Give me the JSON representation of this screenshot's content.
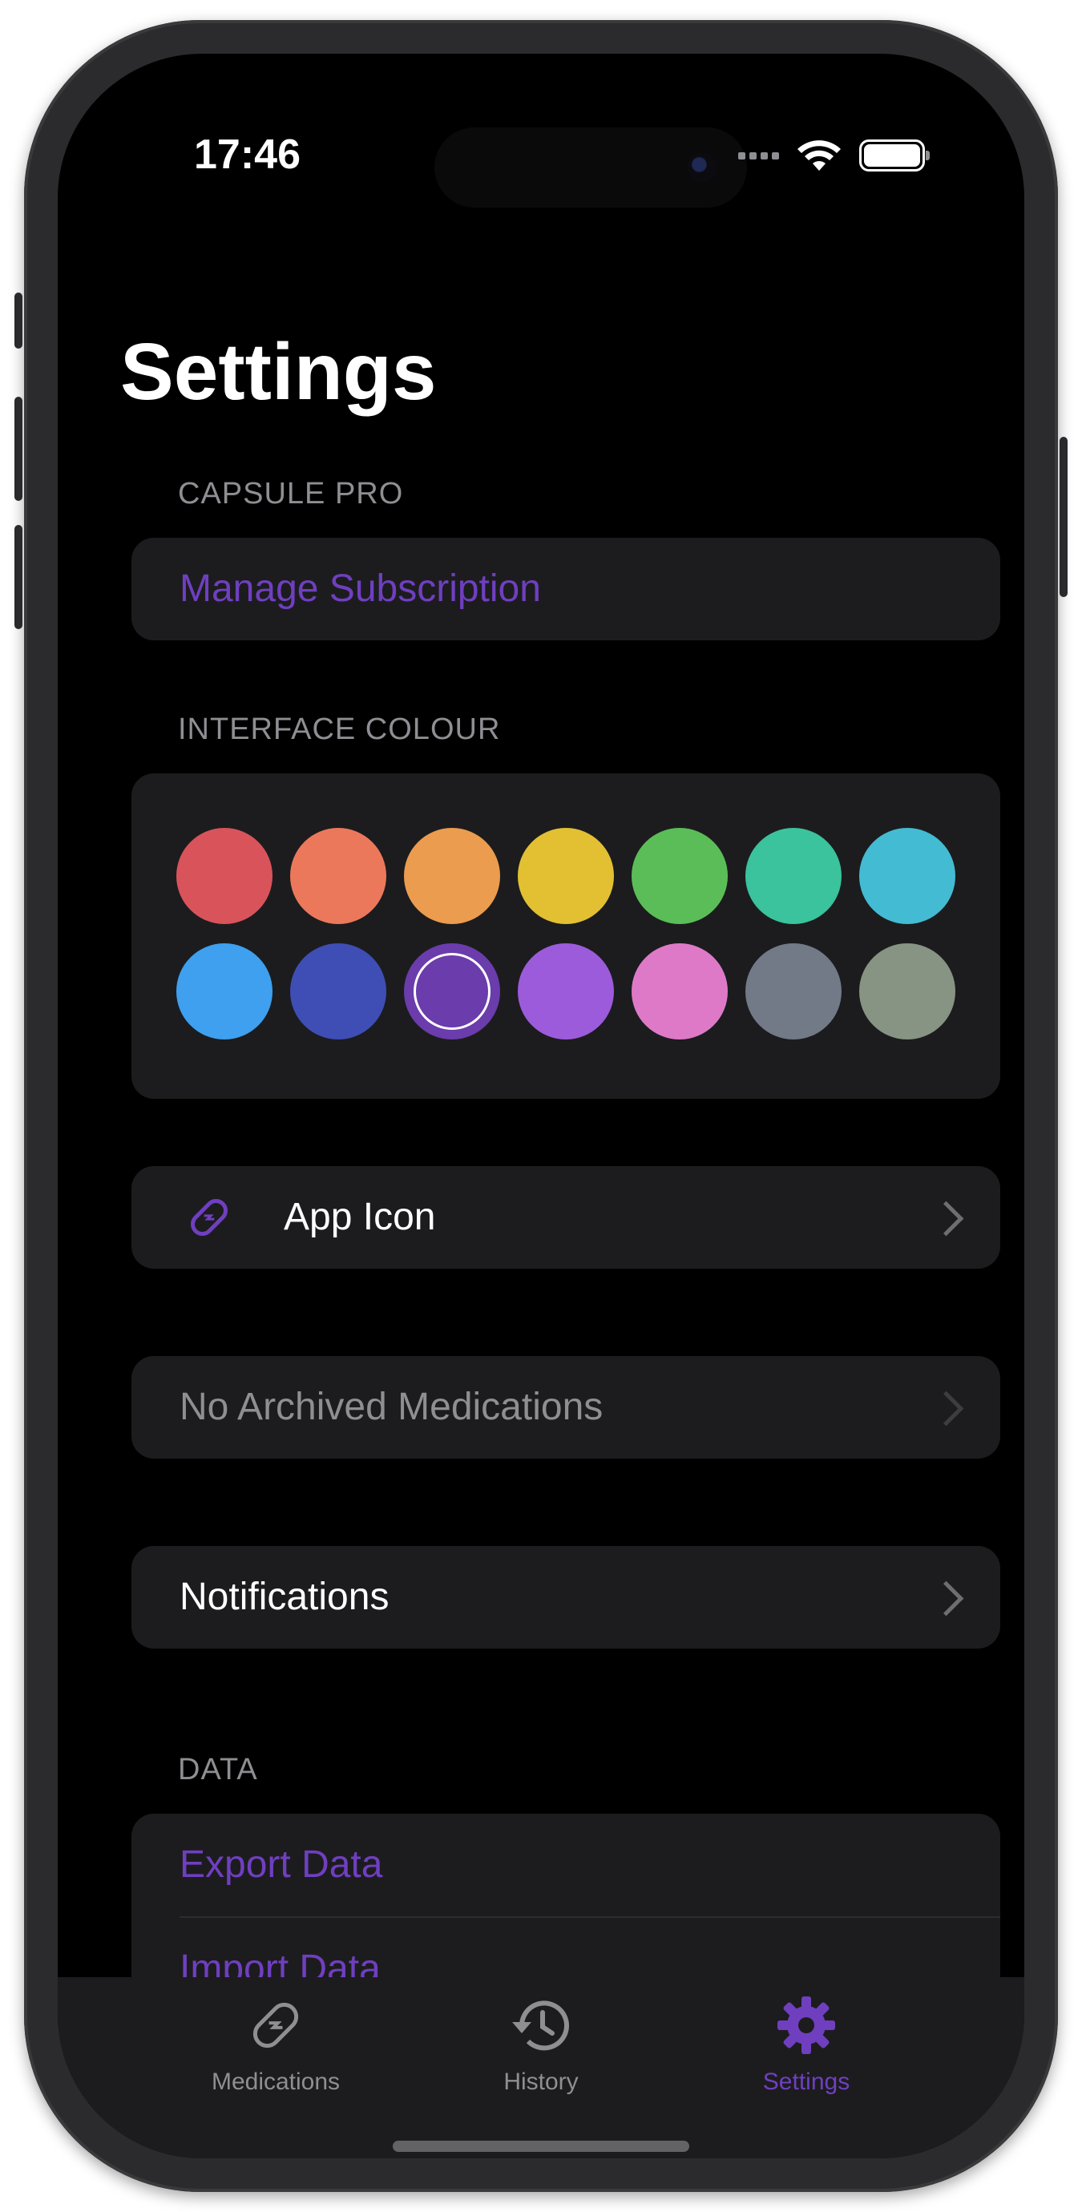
{
  "status": {
    "time": "17:46"
  },
  "page": {
    "title": "Settings"
  },
  "capsule_pro": {
    "header": "CAPSULE PRO",
    "manage_label": "Manage Subscription"
  },
  "interface_colour": {
    "header": "INTERFACE COLOUR",
    "selected_index": 9,
    "swatches": [
      "#d9535b",
      "#ec785c",
      "#eb9c4e",
      "#e2c032",
      "#5bbd58",
      "#3ac39c",
      "#43bbd3",
      "#3ea0ee",
      "#3e4eb5",
      "#6b3cab",
      "#9c5bdb",
      "#de79c8",
      "#727987",
      "#879383"
    ]
  },
  "app_icon": {
    "label": "App Icon",
    "icon": "capsule-icon"
  },
  "archived": {
    "label": "No Archived Medications"
  },
  "notifications": {
    "label": "Notifications"
  },
  "data_section": {
    "header": "DATA",
    "export_label": "Export Data",
    "import_label": "Import Data"
  },
  "colors": {
    "accent": "#6f3fc0",
    "background": "#000000",
    "card": "#1c1c1e",
    "secondary_text": "#8e8e93"
  },
  "tabbar": {
    "tabs": [
      {
        "label": "Medications",
        "icon": "pill-icon",
        "active": false
      },
      {
        "label": "History",
        "icon": "history-clock-icon",
        "active": false
      },
      {
        "label": "Settings",
        "icon": "gear-icon",
        "active": true
      }
    ]
  }
}
